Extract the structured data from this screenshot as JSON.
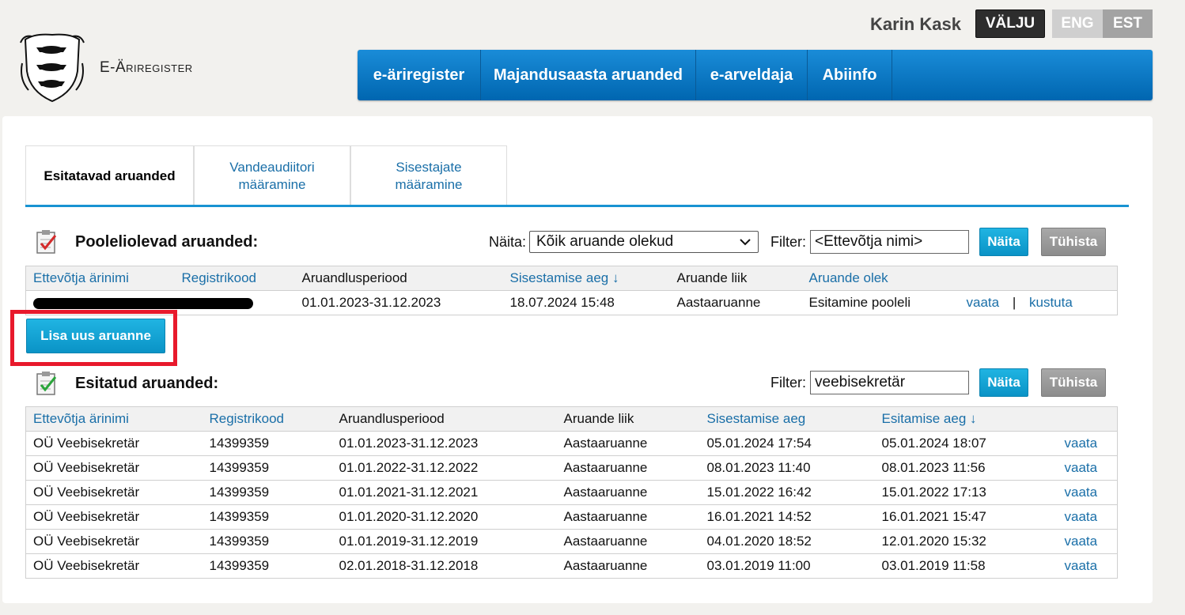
{
  "header": {
    "brand": "E-Äriregister",
    "user_name": "Karin Kask",
    "logout_label": "VÄLJU",
    "lang_eng": "ENG",
    "lang_est": "EST"
  },
  "nav": [
    {
      "label": "e-äriregister"
    },
    {
      "label": "Majandusaasta aruanded"
    },
    {
      "label": "e-arveldaja"
    },
    {
      "label": "Abiinfo"
    }
  ],
  "tabs": [
    {
      "label": "Esitatavad aruanded",
      "active": true
    },
    {
      "label": "Vandeaudiitori määramine"
    },
    {
      "label": "Sisestajate määramine"
    }
  ],
  "pending": {
    "title": "Pooleliolevad aruanded:",
    "show_label": "Näita:",
    "show_value": "Kõik aruande olekud",
    "filter_label": "Filter:",
    "filter_value": "<Ettevõtja nimi>",
    "show_button": "Näita",
    "clear_button": "Tühista",
    "columns": [
      "Ettevõtja ärinimi",
      "Registrikood",
      "Aruandlusperiood",
      "Sisestamise aeg ↓",
      "Aruande liik",
      "Aruande olek"
    ],
    "rows": [
      {
        "period": "01.01.2023-31.12.2023",
        "entered": "18.07.2024 15:48",
        "type": "Aastaaruanne",
        "status": "Esitamine pooleli",
        "view": "vaata",
        "sep": "|",
        "delete": "kustuta"
      }
    ],
    "add_button": "Lisa uus aruanne"
  },
  "submitted": {
    "title": "Esitatud aruanded:",
    "filter_label": "Filter:",
    "filter_value": "veebisekretär",
    "show_button": "Näita",
    "clear_button": "Tühista",
    "columns": [
      "Ettevõtja ärinimi",
      "Registrikood",
      "Aruandlusperiood",
      "Aruande liik",
      "Sisestamise aeg",
      "Esitamise aeg ↓"
    ],
    "rows": [
      {
        "name": "OÜ Veebisekretär",
        "code": "14399359",
        "period": "01.01.2023-31.12.2023",
        "type": "Aastaaruanne",
        "entered": "05.01.2024 17:54",
        "submitted": "05.01.2024 18:07",
        "view": "vaata"
      },
      {
        "name": "OÜ Veebisekretär",
        "code": "14399359",
        "period": "01.01.2022-31.12.2022",
        "type": "Aastaaruanne",
        "entered": "08.01.2023 11:40",
        "submitted": "08.01.2023 11:56",
        "view": "vaata"
      },
      {
        "name": "OÜ Veebisekretär",
        "code": "14399359",
        "period": "01.01.2021-31.12.2021",
        "type": "Aastaaruanne",
        "entered": "15.01.2022 16:42",
        "submitted": "15.01.2022 17:13",
        "view": "vaata"
      },
      {
        "name": "OÜ Veebisekretär",
        "code": "14399359",
        "period": "01.01.2020-31.12.2020",
        "type": "Aastaaruanne",
        "entered": "16.01.2021 14:52",
        "submitted": "16.01.2021 15:47",
        "view": "vaata"
      },
      {
        "name": "OÜ Veebisekretär",
        "code": "14399359",
        "period": "01.01.2019-31.12.2019",
        "type": "Aastaaruanne",
        "entered": "04.01.2020 18:52",
        "submitted": "12.01.2020 15:32",
        "view": "vaata"
      },
      {
        "name": "OÜ Veebisekretär",
        "code": "14399359",
        "period": "02.01.2018-31.12.2018",
        "type": "Aastaaruanne",
        "entered": "03.01.2019 11:00",
        "submitted": "03.01.2019 11:58",
        "view": "vaata"
      }
    ]
  },
  "colors": {
    "accent": "#1893d2",
    "link": "#1a6fa8",
    "highlight": "#e8192c"
  }
}
